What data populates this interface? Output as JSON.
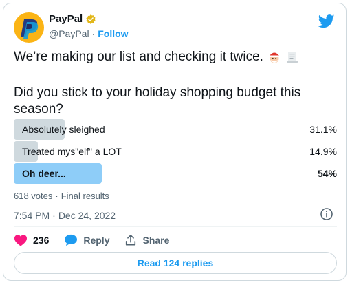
{
  "author": {
    "name": "PayPal",
    "handle": "@PayPal",
    "separator": "·",
    "follow_label": "Follow",
    "avatar_color": "#fbb415",
    "verified_color": "#e2b719"
  },
  "tweet": {
    "line1": "We’re making our list and checking it twice.",
    "line1_emojis": [
      "santa-emoji",
      "scroll-emoji"
    ],
    "question": "Did you stick to your holiday shopping budget this season?"
  },
  "poll": {
    "options": [
      {
        "label": "Absolutely sleighed",
        "percent_text": "31.1%",
        "percent": 31.1,
        "winner": false
      },
      {
        "label": "Treated mys\"elf\" a LOT",
        "percent_text": "14.9%",
        "percent": 14.9,
        "winner": false
      },
      {
        "label": "Oh deer...",
        "percent_text": "54%",
        "percent": 54,
        "winner": true
      }
    ],
    "votes": "618 votes",
    "separator": "·",
    "status": "Final results",
    "bar_color": "#cfd9de",
    "winner_color": "#8ecdf8"
  },
  "meta": {
    "time": "7:54 PM",
    "separator": "·",
    "date": "Dec 24, 2022"
  },
  "actions": {
    "likes": "236",
    "reply_label": "Reply",
    "share_label": "Share",
    "like_color": "#f91880",
    "reply_color": "#1d9bf0"
  },
  "replies_button": "Read 124 replies",
  "colors": {
    "accent": "#1d9bf0",
    "secondary_text": "#536471",
    "border": "#cfd9de"
  }
}
